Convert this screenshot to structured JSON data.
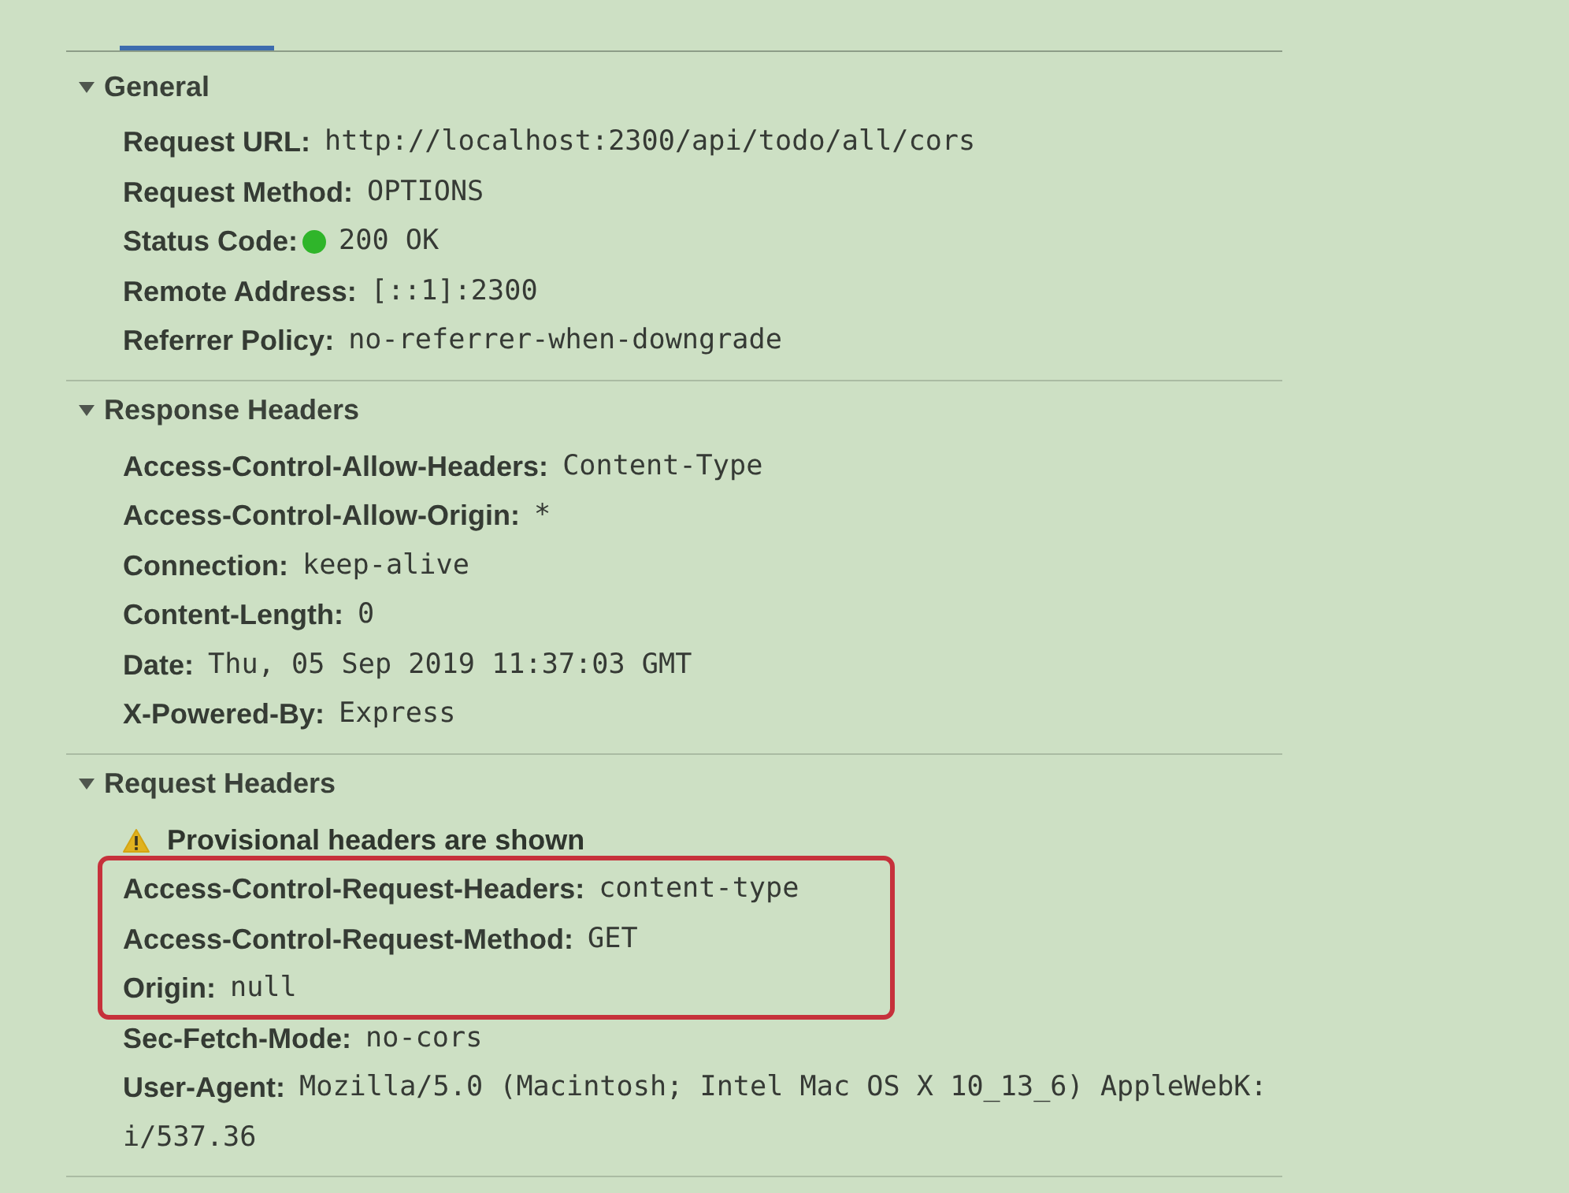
{
  "sections": [
    {
      "title": "General",
      "expanded": true,
      "rows": [
        {
          "kind": "field",
          "label": "Request URL:",
          "value": "http://localhost:2300/api/todo/all/cors"
        },
        {
          "kind": "field",
          "label": "Request Method:",
          "value": "OPTIONS"
        },
        {
          "kind": "status",
          "label": "Status Code:",
          "value": "200 OK",
          "color": "#2fb52a"
        },
        {
          "kind": "field",
          "label": "Remote Address:",
          "value": "[::1]:2300"
        },
        {
          "kind": "field",
          "label": "Referrer Policy:",
          "value": "no-referrer-when-downgrade"
        }
      ]
    },
    {
      "title": "Response Headers",
      "expanded": true,
      "rows": [
        {
          "kind": "field",
          "label": "Access-Control-Allow-Headers:",
          "value": "Content-Type"
        },
        {
          "kind": "field",
          "label": "Access-Control-Allow-Origin:",
          "value": "*"
        },
        {
          "kind": "field",
          "label": "Connection:",
          "value": "keep-alive"
        },
        {
          "kind": "field",
          "label": "Content-Length:",
          "value": "0"
        },
        {
          "kind": "field",
          "label": "Date:",
          "value": "Thu, 05 Sep 2019 11:37:03 GMT"
        },
        {
          "kind": "field",
          "label": "X-Powered-By:",
          "value": "Express"
        }
      ]
    },
    {
      "title": "Request Headers",
      "expanded": true,
      "rows": [
        {
          "kind": "warning",
          "text": "Provisional headers are shown",
          "highlighted": false
        },
        {
          "kind": "field",
          "label": "Access-Control-Request-Headers:",
          "value": "content-type",
          "highlighted": true
        },
        {
          "kind": "field",
          "label": "Access-Control-Request-Method:",
          "value": "GET",
          "highlighted": true
        },
        {
          "kind": "field",
          "label": "Origin:",
          "value": "null",
          "highlighted": true
        },
        {
          "kind": "field",
          "label": "Sec-Fetch-Mode:",
          "value": "no-cors",
          "highlighted": false
        },
        {
          "kind": "field",
          "label": "User-Agent:",
          "value": "Mozilla/5.0 (Macintosh; Intel Mac OS X 10_13_6) AppleWebK:",
          "continuation": "i/537.36",
          "highlighted": false
        }
      ]
    }
  ]
}
